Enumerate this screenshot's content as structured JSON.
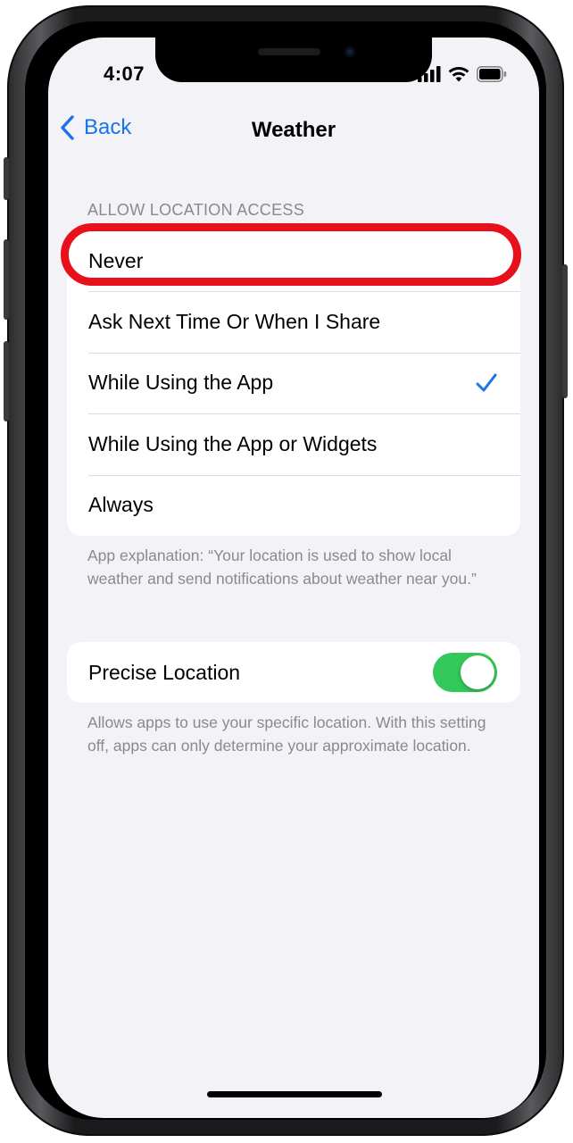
{
  "status_bar": {
    "time": "4:07",
    "icons": [
      "signal-icon",
      "wifi-icon",
      "battery-icon"
    ]
  },
  "nav": {
    "back_label": "Back",
    "title": "Weather"
  },
  "location_access": {
    "header": "ALLOW LOCATION ACCESS",
    "options": [
      {
        "label": "Never",
        "selected": false
      },
      {
        "label": "Ask Next Time Or When I Share",
        "selected": false
      },
      {
        "label": "While Using the App",
        "selected": true
      },
      {
        "label": "While Using the App or Widgets",
        "selected": false
      },
      {
        "label": "Always",
        "selected": false
      }
    ],
    "footer": "App explanation: “Your location is used to show local weather and send notifications about weather near you.”"
  },
  "precise_location": {
    "label": "Precise Location",
    "enabled": true,
    "footer": "Allows apps to use your specific location. With this setting off, apps can only determine your approximate location."
  },
  "colors": {
    "accent": "#1a73e8",
    "toggle_on": "#34c759",
    "highlight": "#e8101a",
    "background": "#f2f2f7"
  }
}
